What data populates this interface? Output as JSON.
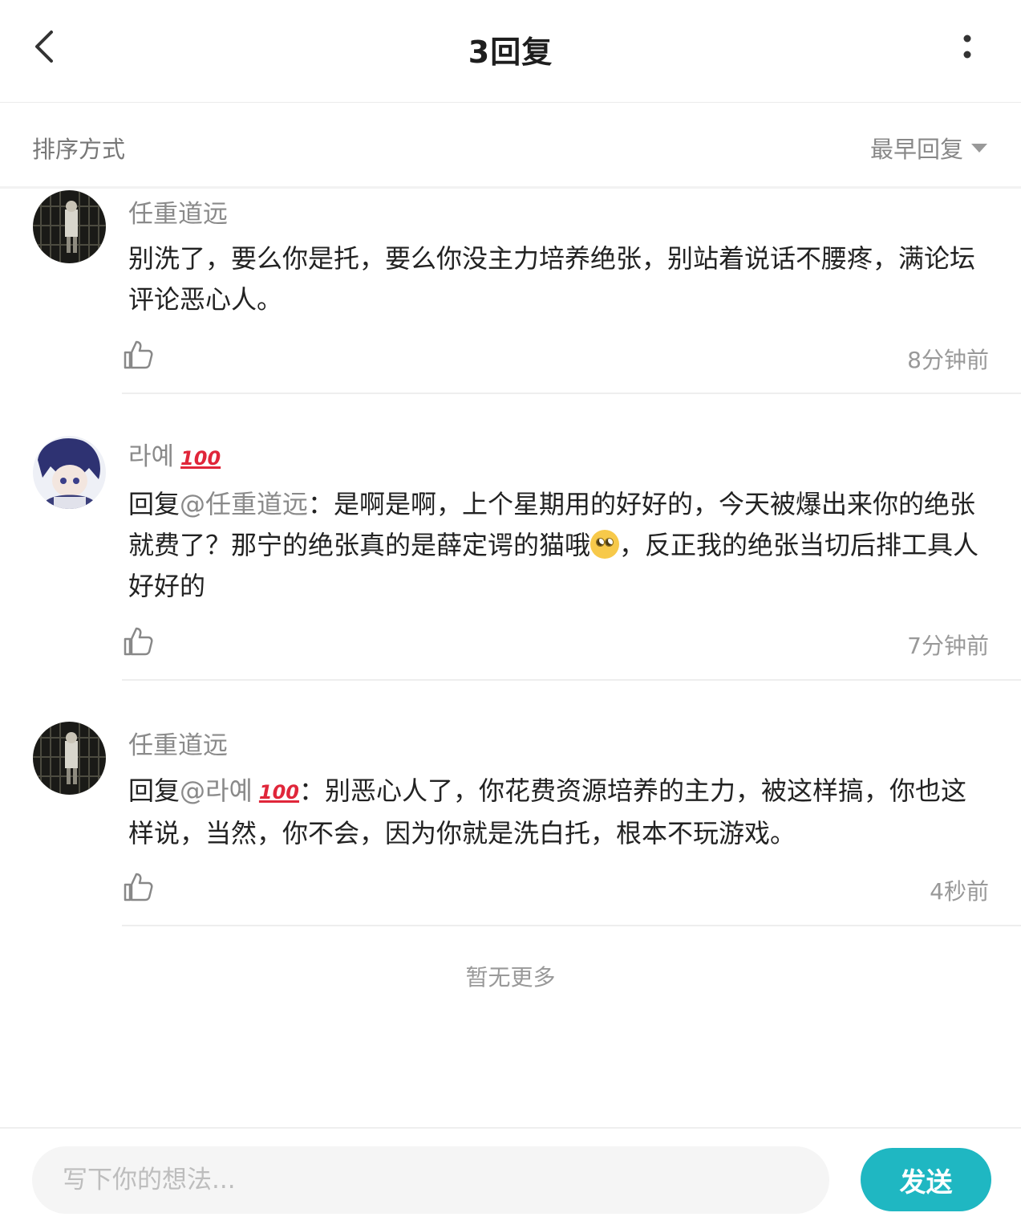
{
  "header": {
    "title": "3回复"
  },
  "sort": {
    "label": "排序方式",
    "selected": "最早回复"
  },
  "replies": [
    {
      "username": "任重道远",
      "badge": "",
      "mention": "",
      "text": "别洗了，要么你是托，要么你没主力培养绝张，别站着说话不腰疼，满论坛评论恶心人。",
      "time": "8分钟前"
    },
    {
      "username": "라예",
      "badge": "100",
      "mention_prefix": "回复",
      "mention": "@任重道远",
      "mention_suffix": "：",
      "text_a": "是啊是啊，上个星期用的好好的，今天被爆出来你的绝张就费了？那宁的绝张真的是薛定谔的猫哦",
      "text_b": "，反正我的绝张当切后排工具人好好的",
      "time": "7分钟前"
    },
    {
      "username": "任重道远",
      "badge": "",
      "mention_prefix": "回复",
      "mention": "@라예",
      "mention_badge": "100",
      "mention_suffix": "：",
      "text": "别恶心人了，你花费资源培养的主力，被这样搞，你也这样说，当然，你不会，因为你就是洗白托，根本不玩游戏。",
      "time": "4秒前"
    }
  ],
  "footer_note": "暂无更多",
  "composer": {
    "placeholder": "写下你的想法...",
    "send_label": "发送"
  },
  "colors": {
    "accent": "#1fb7c2",
    "badge": "#e0263a",
    "muted": "#8a8a8a"
  }
}
